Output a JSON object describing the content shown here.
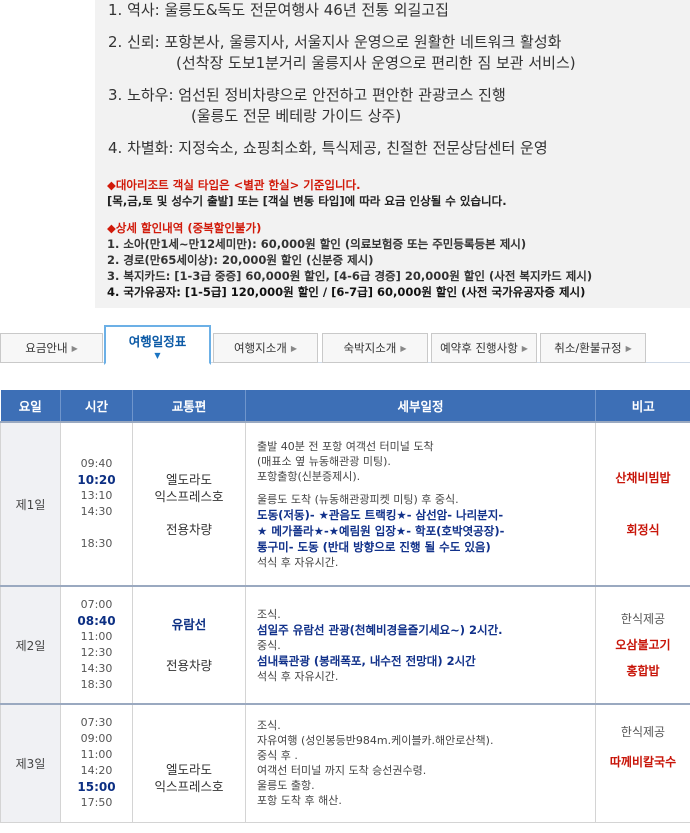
{
  "intro": {
    "points": [
      {
        "text": "1. 역사: 울릉도&독도 전문여행사 46년 전통 외길고집",
        "sub": ""
      },
      {
        "text": "2. 신뢰: 포항본사, 울릉지사, 서울지사 운영으로 원활한 네트워크 활성화",
        "sub": "(선착장 도보1분거리 울릉지사 운영으로 편리한 짐 보관 서비스)"
      },
      {
        "text": "3. 노하우: 엄선된 정비차량으로 안전하고 편안한 관광코스 진행",
        "sub": "(울릉도 전문 베테랑 가이드 상주)"
      },
      {
        "text": "4. 차별화: 지정숙소, 쇼핑최소화, 특식제공, 친절한 전문상담센터 운영",
        "sub": ""
      }
    ],
    "notice_title": "◆대아리조트 객실 타입은 <별관 한실> 기준입니다.",
    "notice_body": "[목,금,토 및 성수기 출발] 또는 [객실 변동 타입]에 따라 요금 인상될 수 있습니다.",
    "discount_title": "◆상세 할인내역 (중복할인불가)",
    "discounts": [
      "1. 소아(만1세~만12세미만): 60,000원 할인 (의료보험증 또는 주민등록등본 제시)",
      "2. 경로(만65세이상): 20,000원 할인 (신분증 제시)",
      "3. 복지카드: [1-3급 중증] 60,000원 할인, [4-6급 경증] 20,000원 할인 (사전 복지카드 제시)",
      "4. 국가유공자: [1-5급] 120,000원 할인 / [6-7급] 60,000원 할인 (사전 국가유공자증 제시)"
    ]
  },
  "tabs": [
    {
      "label": "요금안내"
    },
    {
      "label": "여행일정표"
    },
    {
      "label": "여행지소개"
    },
    {
      "label": "숙박지소개"
    },
    {
      "label": "예약후 진행사항"
    },
    {
      "label": "취소/환불규정"
    }
  ],
  "table": {
    "headers": [
      "요일",
      "시간",
      "교통편",
      "세부일정",
      "비고"
    ],
    "rows": [
      {
        "day": "제1일",
        "times": [
          "09:40",
          "10:20",
          "13:10",
          "14:30",
          "",
          "18:30"
        ],
        "transport": [
          "엘도라도",
          "익스프레스호",
          "",
          "전용차량"
        ],
        "schedule": [
          "출발 40분 전 포항 여객선 터미널 도착",
          "(매표소 옆 뉴동해관광 미팅).",
          "포항출항(신분증제시).",
          "",
          "울릉도 도착 (뉴동해관광피켓 미팅) 후 중식.",
          "도동(저동)- ★관음도 트랙킹★- 삼선암- 나리분지-",
          "★ 메가폴라★-★예림원 입장★- 학포(호박엿공장)-",
          "통구미- 도동 (반대 방향으로 진행 될 수도 있음)",
          "석식 후 자유시간."
        ],
        "notes": [
          "산채비빔밥",
          "",
          "회정식"
        ]
      },
      {
        "day": "제2일",
        "times": [
          "07:00",
          "08:40",
          "11:00",
          "12:30",
          "14:30",
          "18:30"
        ],
        "transport": [
          "유람선",
          "",
          "전용차량"
        ],
        "schedule": [
          "조식.",
          "섬일주 유람선 관광(천혜비경을즐기세요~) 2시간.",
          "중식.",
          "섬내륙관광 (봉래폭포, 내수전 전망대) 2시간",
          "석식 후 자유시간."
        ],
        "notes": [
          "한식제공",
          "오삼불고기",
          "홍합밥"
        ]
      },
      {
        "day": "제3일",
        "times": [
          "07:30",
          "09:00",
          "11:00",
          "14:20",
          "15:00",
          "17:50"
        ],
        "transport": [
          "엘도라도",
          "익스프레스호"
        ],
        "schedule": [
          "조식.",
          "자유여행 (성인봉등반984m.케이블카.해안로산책).",
          "중식 후 .",
          "여객선 터미널 까지 도착 승선권수령.",
          "울릉도 출항.",
          "포항 도착 후 해산."
        ],
        "notes": [
          "한식제공",
          "따께비칼국수"
        ]
      }
    ]
  }
}
